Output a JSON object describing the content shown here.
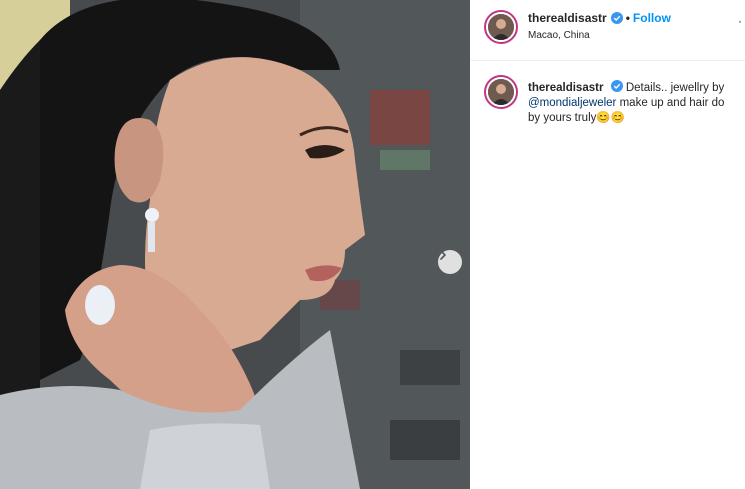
{
  "post": {
    "username": "therealdisastr",
    "location": "Macao, China",
    "follow_label": "Follow",
    "separator": "•",
    "more_label": "·",
    "caption": {
      "username": "therealdisastr",
      "text_before": "Details.. jewellry by",
      "mention": "@mondialjeweler",
      "text_after": "make up and hair do by yours truly",
      "emoji": "😊😊"
    }
  },
  "colors": {
    "accent": "#0095f6",
    "verified": "#3897f0",
    "mention": "#00376b",
    "story_ring": "#c13584"
  },
  "icons": {
    "next": "chevron-right-icon",
    "verified": "verified-badge-icon"
  }
}
